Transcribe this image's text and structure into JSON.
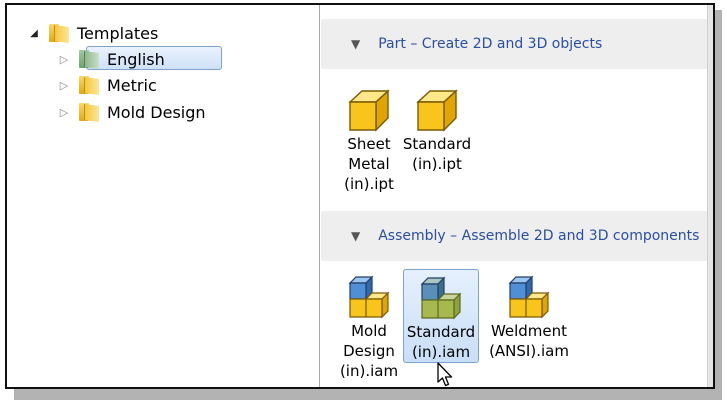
{
  "tree": {
    "root": {
      "label": "Templates"
    },
    "children": [
      {
        "label": "English",
        "selected": true
      },
      {
        "label": "Metric"
      },
      {
        "label": "Mold Design"
      }
    ]
  },
  "groups": {
    "part": {
      "header": "Part – Create 2D and 3D objects",
      "items": [
        {
          "label": "Sheet\nMetal\n(in).ipt"
        },
        {
          "label": "Standard\n(in).ipt"
        }
      ]
    },
    "assembly": {
      "header": "Assembly – Assemble 2D and 3D components",
      "items": [
        {
          "label": "Mold\nDesign\n(in).iam"
        },
        {
          "label": "Standard\n(in).iam",
          "selected": true
        },
        {
          "label": "Weldment\n(ANSI).iam"
        }
      ]
    }
  },
  "colors": {
    "header_text": "#2a4fa0",
    "selection_border": "#7da2ce",
    "part_cube": "#f5c000",
    "assembly_blue": "#3e7fcc"
  }
}
